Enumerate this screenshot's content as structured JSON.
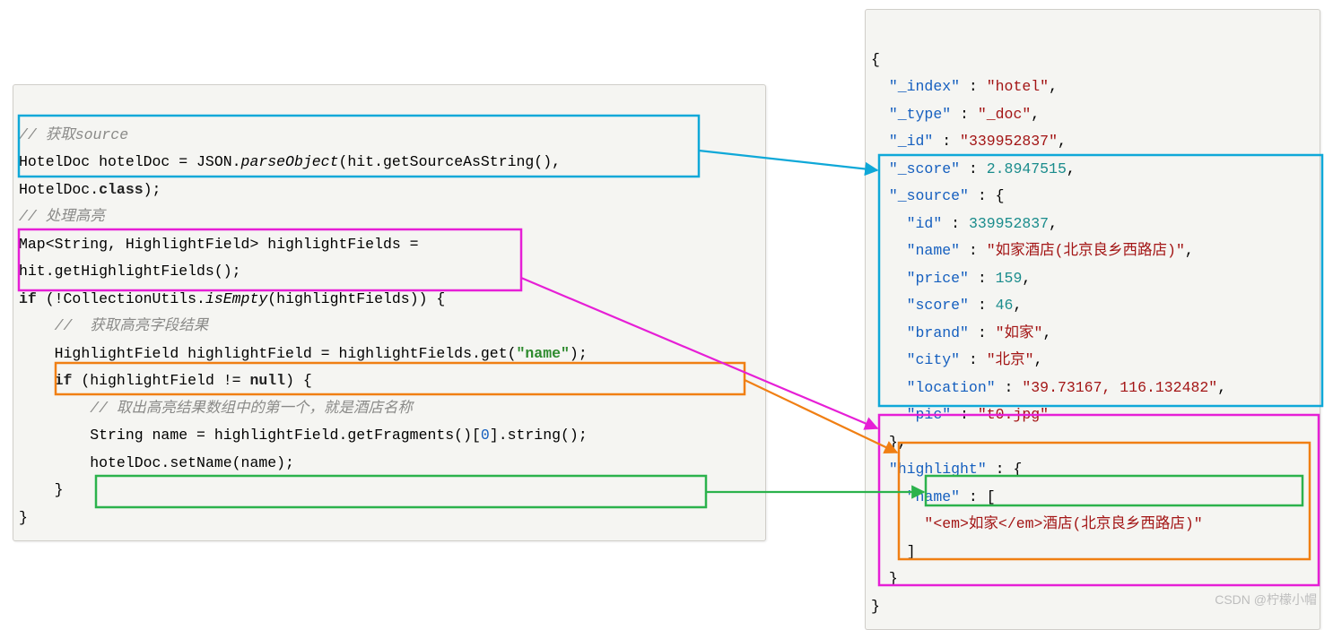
{
  "left": {
    "c1": "// 获取source",
    "l1_t1": "HotelDoc hotelDoc = JSON.",
    "l1_m": "parseObject",
    "l1_t2": "(hit.getSourceAsString(),",
    "l2": "HotelDoc.",
    "l2_k": "class",
    "l2_t": ");",
    "c2": "// 处理高亮",
    "l3": "Map<String, HighlightField> highlightFields =",
    "l4": "hit.getHighlightFields();",
    "l5_a": "if",
    "l5_b": " (!CollectionUtils.",
    "l5_m": "isEmpty",
    "l5_c": "(highlightFields)) {",
    "c3": "//  获取高亮字段结果",
    "l6_a": "HighlightField highlightField = highlightFields.get(",
    "l6_s": "\"name\"",
    "l6_b": ");",
    "l7_a": "if",
    "l7_b": " (highlightField != ",
    "l7_n": "null",
    "l7_c": ") {",
    "c4": "// 取出高亮结果数组中的第一个，就是酒店名称",
    "l8_a": "String name = highlightField.getFragments()[",
    "l8_i": "0",
    "l8_b": "].string();",
    "l9": "hotelDoc.setName(name);",
    "l10": "}",
    "l11": "}"
  },
  "right": {
    "open": "{",
    "k_index": "\"_index\"",
    "sep": " : ",
    "v_index": "\"hotel\"",
    "comma": ",",
    "k_type": "\"_type\"",
    "v_type": "\"_doc\"",
    "k_id": "\"_id\"",
    "v_id": "\"339952837\"",
    "k_score": "\"_score\"",
    "v_score": "2.8947515",
    "k_source": "\"_source\"",
    "v_source_open": " : {",
    "k_sid": "\"id\"",
    "v_sid": "339952837",
    "k_name": "\"name\"",
    "v_name": "\"如家酒店(北京良乡西路店)\"",
    "k_price": "\"price\"",
    "v_price": "159",
    "k_sscore": "\"score\"",
    "v_sscore": "46",
    "k_brand": "\"brand\"",
    "v_brand": "\"如家\"",
    "k_city": "\"city\"",
    "v_city": "\"北京\"",
    "k_loc": "\"location\"",
    "v_loc": "\"39.73167, 116.132482\"",
    "k_pic": "\"pic\"",
    "v_pic": "\"t0.jpg\"",
    "close_brace": "},",
    "k_hl": "\"highlight\"",
    "v_hl_open": " : {",
    "k_hname": "\"name\"",
    "v_hname_open": " : [",
    "v_hname_val": "\"<em>如家</em>酒店(北京良乡西路店)\"",
    "close_arr": "]",
    "close_brace2": "}",
    "close_all": "}"
  },
  "watermark": "CSDN @柠檬小帽"
}
